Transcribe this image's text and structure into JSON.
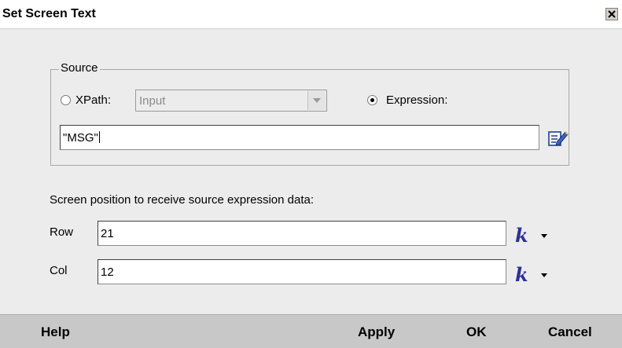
{
  "window": {
    "title": "Set Screen Text"
  },
  "source": {
    "group_label": "Source",
    "xpath_label": "XPath:",
    "xpath_selected": false,
    "xpath_value": "Input",
    "expression_label": "Expression:",
    "expression_selected": true,
    "expression_value": "\"MSG\""
  },
  "position": {
    "instruction": "Screen position to receive source expression data:",
    "row_label": "Row",
    "row_value": "21",
    "col_label": "Col",
    "col_value": "12",
    "k_symbol": "k"
  },
  "buttons": {
    "help": "Help",
    "apply": "Apply",
    "ok": "OK",
    "cancel": "Cancel"
  },
  "icons": {
    "close": "close-icon",
    "dropdown": "chevron-down-icon",
    "expression_editor": "edit-pencil-icon",
    "k_menu": "caret-down-icon"
  },
  "colors": {
    "title_bg": "#ffffff",
    "dialog_bg": "#ececec",
    "button_bar": "#c8c8c8",
    "k_symbol": "#2e2e9e"
  }
}
